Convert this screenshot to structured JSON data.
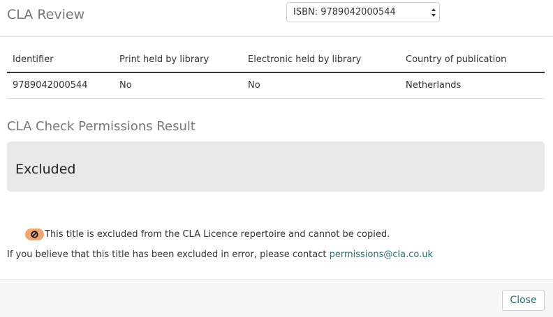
{
  "header": {
    "title": "CLA Review",
    "isbn_select": {
      "selected": "ISBN: 9789042000544"
    }
  },
  "table": {
    "columns": [
      "Identifier",
      "Print held by library",
      "Electronic held by library",
      "Country of publication"
    ],
    "rows": [
      [
        "9789042000544",
        "No",
        "No",
        "Netherlands"
      ]
    ]
  },
  "result": {
    "heading": "CLA Check Permissions Result",
    "status": "Excluded"
  },
  "notice": {
    "icon": "no-entry-icon",
    "icon_color": "#f1a572",
    "text": "This title is excluded from the CLA Licence repertoire and cannot be copied."
  },
  "contact": {
    "text": "If you believe that this title has been excluded in error, please contact",
    "email": "permissions@cla.co.uk"
  },
  "footer": {
    "close_label": "Close"
  },
  "colors": {
    "link": "#2a6d73",
    "well": "#e9e9e9",
    "muted_heading": "#777777"
  }
}
